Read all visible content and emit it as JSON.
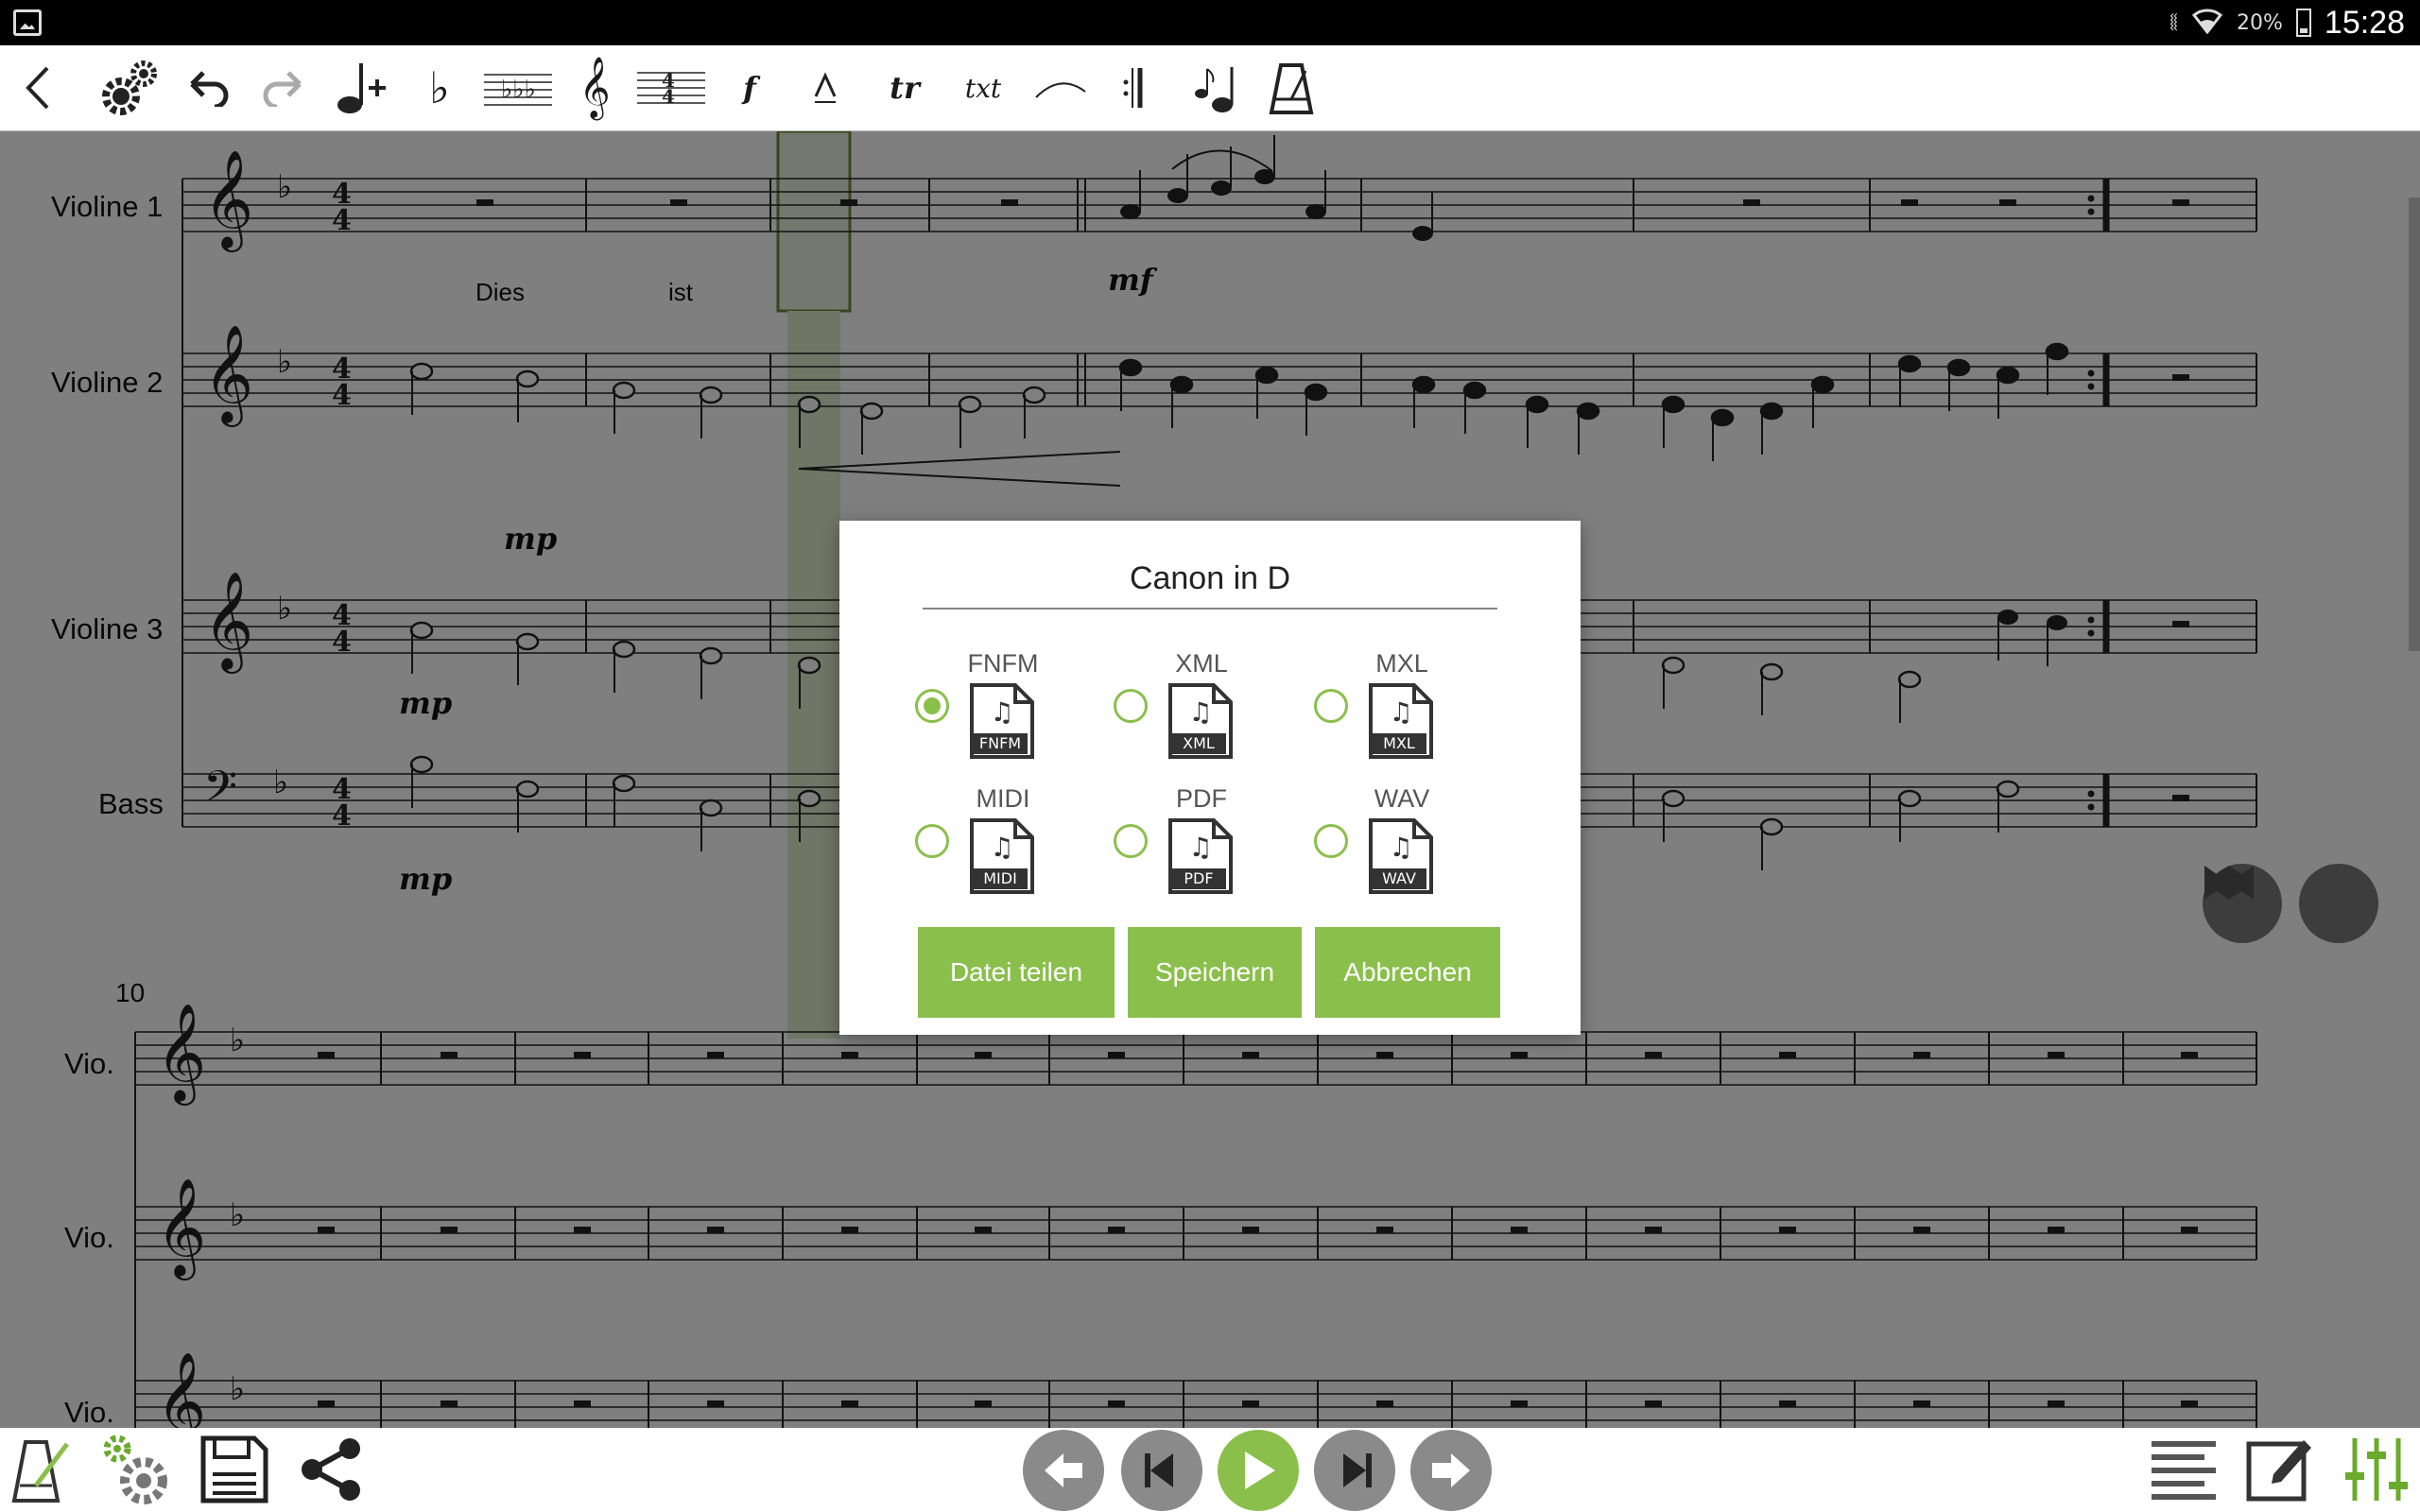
{
  "status_bar": {
    "battery_percent": "20%",
    "time": "15:28",
    "icons": [
      "gallery-icon",
      "mute-vibrate-icon",
      "wifi-icon",
      "battery-icon"
    ]
  },
  "toolbar": {
    "icons": [
      "back-icon",
      "settings-icon",
      "undo-icon",
      "redo-icon",
      "add-note-icon",
      "flat-icon",
      "key-signature-icon",
      "treble-clef-icon",
      "time-signature-icon",
      "dynamics-icon",
      "accent-icon",
      "trill-icon",
      "text-icon",
      "slur-icon",
      "repeat-bar-icon",
      "grace-note-icon",
      "metronome-icon"
    ],
    "dynamics_label": "f",
    "trill_label": "tr",
    "text_label": "txt"
  },
  "score": {
    "instruments": [
      "Violine 1",
      "Violine 2",
      "Violine 3",
      "Bass"
    ],
    "lyrics": [
      "Dies",
      "ist"
    ],
    "dynamics": [
      "mf",
      "mp",
      "mp",
      "mp"
    ],
    "second_system_measure": "10",
    "second_system_labels": [
      "Vio.",
      "Vio.",
      "Vio."
    ]
  },
  "dialog": {
    "title": "Canon in D",
    "formats": [
      {
        "label": "FNFM",
        "tag": "FNFM",
        "selected": true
      },
      {
        "label": "XML",
        "tag": "XML",
        "selected": false
      },
      {
        "label": "MXL",
        "tag": "MXL",
        "selected": false
      },
      {
        "label": "MIDI",
        "tag": "MIDI",
        "selected": false
      },
      {
        "label": "PDF",
        "tag": "PDF",
        "selected": false
      },
      {
        "label": "WAV",
        "tag": "WAV",
        "selected": false
      }
    ],
    "buttons": {
      "share": "Datei teilen",
      "save": "Speichern",
      "cancel": "Abbrechen"
    }
  },
  "bottom_bar": {
    "left_icons": [
      "metronome-edit-icon",
      "settings-gears-icon",
      "save-disk-icon",
      "share-icon"
    ],
    "playback_icons": [
      "previous-icon",
      "step-back-icon",
      "play-icon",
      "step-forward-icon",
      "next-icon"
    ],
    "right_icons": [
      "page-view-icon",
      "edit-icon",
      "mixer-icon"
    ]
  },
  "colors": {
    "accent": "#8bbf4c",
    "dim_overlay": "rgba(0,0,0,0.5)",
    "playback_grey": "#8a8a8a"
  }
}
